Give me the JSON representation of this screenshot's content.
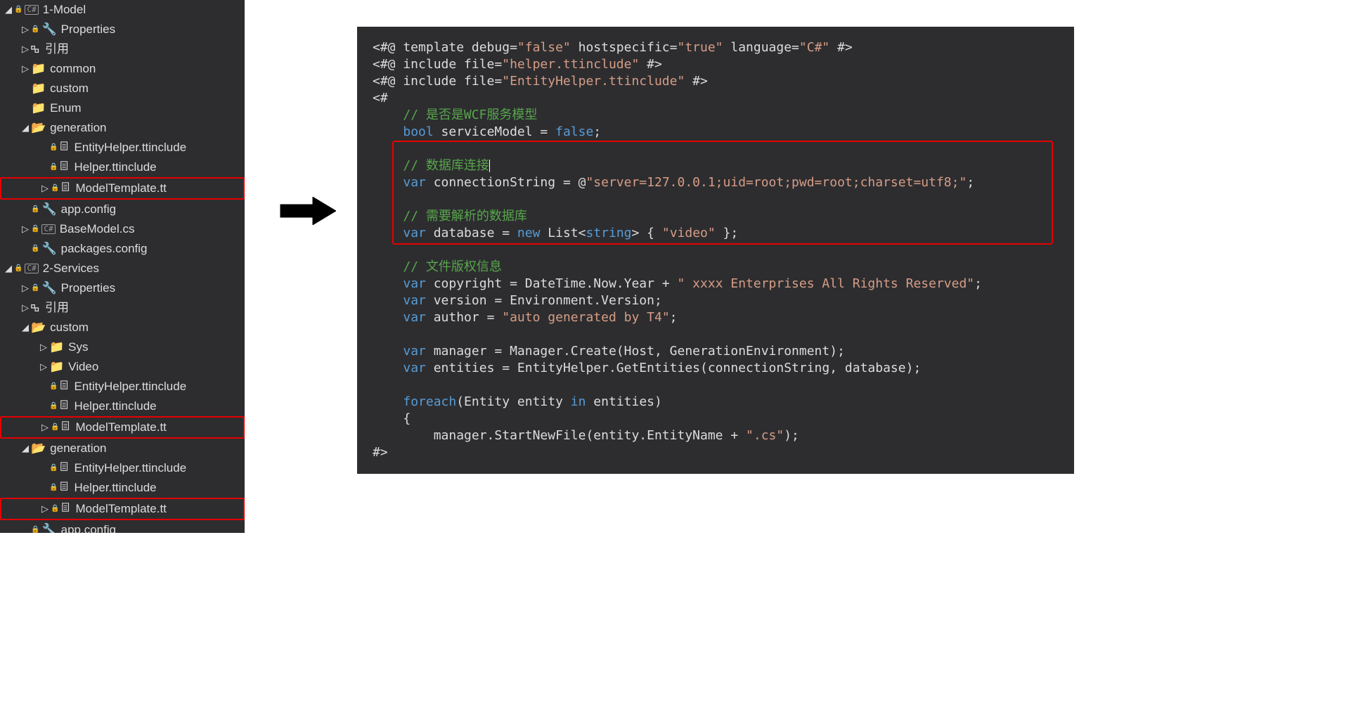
{
  "tree": {
    "projects": [
      {
        "name": "1-Model"
      },
      {
        "name": "2-Services"
      }
    ],
    "model": {
      "properties": "Properties",
      "references": "引用",
      "folders": [
        "common",
        "custom",
        "Enum",
        "generation"
      ],
      "generation_files": [
        "EntityHelper.ttinclude",
        "Helper.ttinclude",
        "ModelTemplate.tt"
      ],
      "app_config": "app.config",
      "base_model": "BaseModel.cs",
      "packages_config": "packages.config"
    },
    "services": {
      "properties": "Properties",
      "references": "引用",
      "custom": "custom",
      "custom_subfolders": [
        "Sys",
        "Video"
      ],
      "custom_files": [
        "EntityHelper.ttinclude",
        "Helper.ttinclude",
        "ModelTemplate.tt"
      ],
      "generation": "generation",
      "generation_files": [
        "EntityHelper.ttinclude",
        "Helper.ttinclude",
        "ModelTemplate.tt"
      ],
      "app_config": "app.config"
    }
  },
  "code": {
    "lines": {
      "l1a": "<#@ template debug=",
      "l1b": "\"false\"",
      "l1c": " hostspecific=",
      "l1d": "\"true\"",
      "l1e": " language=",
      "l1f": "\"C#\"",
      "l1g": " #>",
      "l2a": "<#@ include file=",
      "l2b": "\"helper.ttinclude\"",
      "l2c": " #>",
      "l3a": "<#@ include file=",
      "l3b": "\"EntityHelper.ttinclude\"",
      "l3c": " #>",
      "l4": "<#",
      "c1": "// 是否是WCF服务模型",
      "l5a": "bool",
      "l5b": " serviceModel = ",
      "l5c": "false",
      "l5d": ";",
      "c2": "// 数据库连接",
      "l6a": "var",
      "l6b": " connectionString = @",
      "l6c": "\"server=127.0.0.1;uid=root;pwd=root;charset=utf8;\"",
      "l6d": ";",
      "c3": "// 需要解析的数据库",
      "l7a": "var",
      "l7b": " database = ",
      "l7c": "new",
      "l7d": " List<",
      "l7e": "string",
      "l7f": "> { ",
      "l7g": "\"video\"",
      "l7h": " };",
      "c4": "// 文件版权信息",
      "l8a": "var",
      "l8b": " copyright = DateTime.Now.Year + ",
      "l8c": "\" xxxx Enterprises All Rights Reserved\"",
      "l8d": ";",
      "l9a": "var",
      "l9b": " version = Environment.Version;",
      "l10a": "var",
      "l10b": " author = ",
      "l10c": "\"auto generated by T4\"",
      "l10d": ";",
      "l11a": "var",
      "l11b": " manager = Manager.Create(Host, GenerationEnvironment);",
      "l12a": "var",
      "l12b": " entities = EntityHelper.GetEntities(connectionString, database);",
      "l13a": "foreach",
      "l13b": "(Entity entity ",
      "l13c": "in",
      "l13d": " entities)",
      "l14": "{",
      "l15a": "manager.StartNewFile(entity.EntityName + ",
      "l15b": "\".cs\"",
      "l15c": ");",
      "l16": "#>"
    }
  }
}
